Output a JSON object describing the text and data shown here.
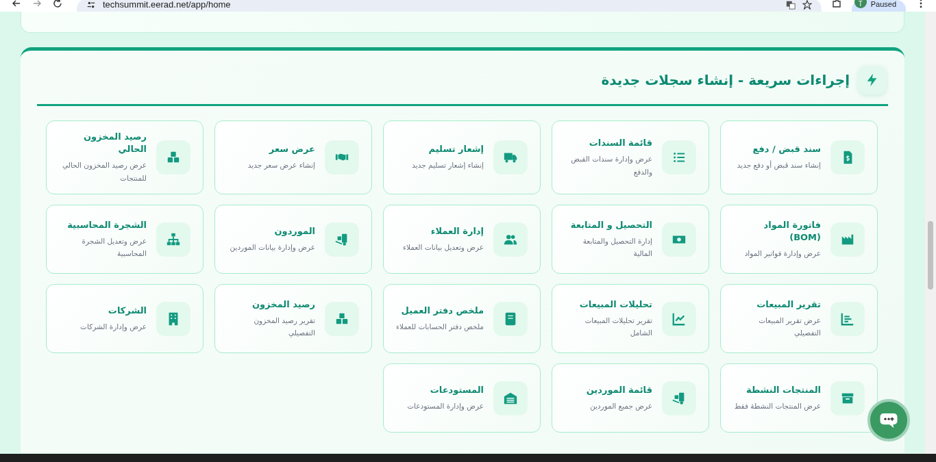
{
  "browser": {
    "url": "techsummit.eerad.net/app/home",
    "profile_initial": "T",
    "profile_status": "Paused"
  },
  "quick_actions": {
    "title": "إجراءات سريعة - إنشاء سجلات جديدة",
    "items": [
      {
        "title": "سند قبض / دفع",
        "description": "إنشاء سند قبض أو دفع جديد"
      },
      {
        "title": "قائمة السندات",
        "description": "عرض وإدارة سندات القبض والدفع"
      },
      {
        "title": "إشعار تسليم",
        "description": "إنشاء إشعار تسليم جديد"
      },
      {
        "title": "عرض سعر",
        "description": "إنشاء عرض سعر جديد"
      },
      {
        "title": "رصيد المخزون الحالي",
        "description": "عرض رصيد المخزون الحالي للمنتجات"
      },
      {
        "title": "فاتورة المواد (BOM)",
        "description": "عرض وإدارة فواتير المواد"
      },
      {
        "title": "التحصيل و المتابعة",
        "description": "إدارة التحصيل والمتابعة المالية"
      },
      {
        "title": "إدارة العملاء",
        "description": "عرض وتعديل بيانات العملاء"
      },
      {
        "title": "الموردون",
        "description": "عرض وإدارة بيانات الموردين"
      },
      {
        "title": "الشجرة المحاسبية",
        "description": "عرض وتعديل الشجرة المحاسبية"
      },
      {
        "title": "تقرير المبيعات",
        "description": "عرض تقرير المبيعات التفصيلي"
      },
      {
        "title": "تحليلات المبيعات",
        "description": "تقرير تحليلات المبيعات الشامل"
      },
      {
        "title": "ملخص دفتر العميل",
        "description": "ملخص دفتر الحسابات للعملاء"
      },
      {
        "title": "رصيد المخزون",
        "description": "تقرير رصيد المخزون التفصيلي"
      },
      {
        "title": "الشركات",
        "description": "عرض وإدارة الشركات"
      },
      {
        "title": "المنتجات النشطة",
        "description": "عرض المنتجات النشطة فقط"
      },
      {
        "title": "قائمة الموردين",
        "description": "عرض جميع الموردين"
      },
      {
        "title": "المستودعات",
        "description": "عرض وإدارة المستودعات"
      }
    ]
  }
}
